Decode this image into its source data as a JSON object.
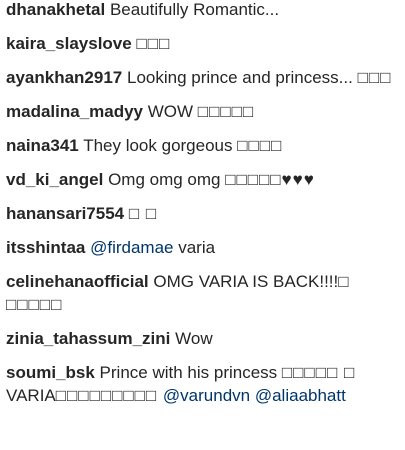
{
  "comments": [
    {
      "username": "dhanakhetal",
      "parts": [
        {
          "text": "Beautifully Romantic..."
        }
      ]
    },
    {
      "username": "kaira_slayslove",
      "parts": [
        {
          "text": "□□□",
          "glyph": true
        }
      ]
    },
    {
      "username": "ayankhan2917",
      "parts": [
        {
          "text": "Looking prince and princess... "
        },
        {
          "text": "□□□",
          "glyph": true
        }
      ]
    },
    {
      "username": "madalina_madyy",
      "parts": [
        {
          "text": "WOW "
        },
        {
          "text": "□□□□□",
          "glyph": true
        }
      ]
    },
    {
      "username": "naina341",
      "parts": [
        {
          "text": "They look gorgeous "
        },
        {
          "text": "□□□□",
          "glyph": true
        }
      ]
    },
    {
      "username": "vd_ki_angel",
      "parts": [
        {
          "text": "Omg omg omg "
        },
        {
          "text": "□□□□□♥♥♥",
          "glyph": true
        }
      ]
    },
    {
      "username": "hanansari7554",
      "parts": [
        {
          "text": "□ □",
          "glyph": true
        }
      ]
    },
    {
      "username": "itsshintaa",
      "parts": [
        {
          "text": "@firdamae",
          "mention": true
        },
        {
          "text": " varia"
        }
      ]
    },
    {
      "username": "celinehanaofficial",
      "parts": [
        {
          "text": "OMG VARIA IS BACK!!!!"
        },
        {
          "text": "□ □□□□□",
          "glyph": true
        }
      ]
    },
    {
      "username": "zinia_tahassum_zini",
      "parts": [
        {
          "text": "Wow"
        }
      ]
    },
    {
      "username": "soumi_bsk",
      "parts": [
        {
          "text": "Prince with his princess "
        },
        {
          "text": "□□□□□ □",
          "glyph": true
        },
        {
          "text": " VARIA"
        },
        {
          "text": "□□□□□□□□□ ",
          "glyph": true
        },
        {
          "text": "@varundvn",
          "mention": true
        },
        {
          "text": " "
        },
        {
          "text": "@aliaabhatt",
          "mention": true
        }
      ]
    }
  ]
}
